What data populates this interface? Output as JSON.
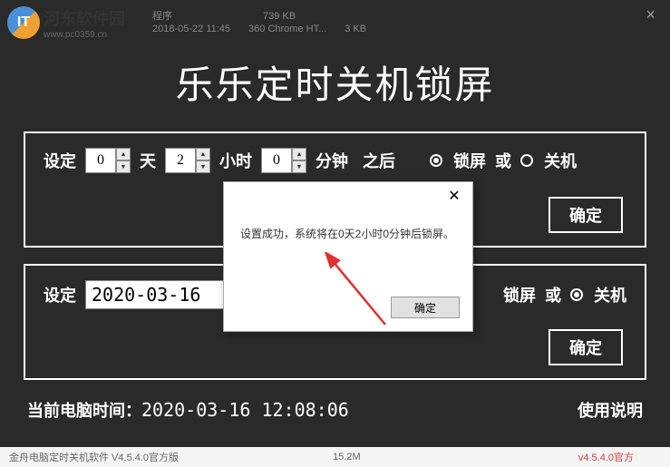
{
  "watermark": {
    "brand": "河东软件园",
    "url": "www.pc0359.cn"
  },
  "header_files": {
    "line1_name": "程序",
    "line1_size": "739 KB",
    "line2_date": "2018-05-22 11:45",
    "line2_name": "360 Chrome HT...",
    "line2_size": "3 KB"
  },
  "window": {
    "title": "乐乐定时关机锁屏"
  },
  "panel1": {
    "label_set": "设定",
    "days": "0",
    "label_days": "天",
    "hours": "2",
    "label_hours": "小时",
    "minutes": "0",
    "label_minutes": "分钟",
    "label_after": "之后",
    "opt_lock": "锁屏",
    "label_or": "或",
    "opt_shutdown": "关机",
    "confirm": "确定",
    "selected": "lock"
  },
  "panel2": {
    "label_set": "设定",
    "date": "2020-03-16",
    "opt_lock": "锁屏",
    "label_or": "或",
    "opt_shutdown": "关机",
    "confirm": "确定",
    "selected": "shutdown"
  },
  "footer": {
    "label": "当前电脑时间：",
    "time": "2020-03-16 12:08:06",
    "help": "使用说明"
  },
  "bottom": {
    "text": "金舟电脑定时关机软件 V4.5.4.0官方版",
    "size": "15.2M",
    "version": "v4.5.4.0官方"
  },
  "modal": {
    "message": "设置成功，系统将在0天2小时0分钟后锁屏。",
    "ok": "确定"
  }
}
